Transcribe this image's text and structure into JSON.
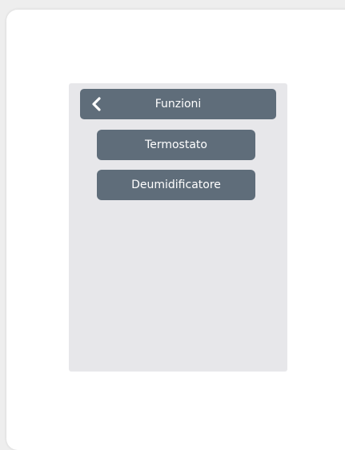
{
  "header": {
    "back_icon": "chevron-left-icon",
    "title": "Funzioni"
  },
  "menu": {
    "items": [
      {
        "label": "Termostato"
      },
      {
        "label": "Deumidificatore"
      }
    ]
  },
  "colors": {
    "button_bg": "#5f6d7a",
    "panel_bg": "#e7e7ea",
    "card_bg": "#ffffff",
    "text": "#ffffff"
  }
}
